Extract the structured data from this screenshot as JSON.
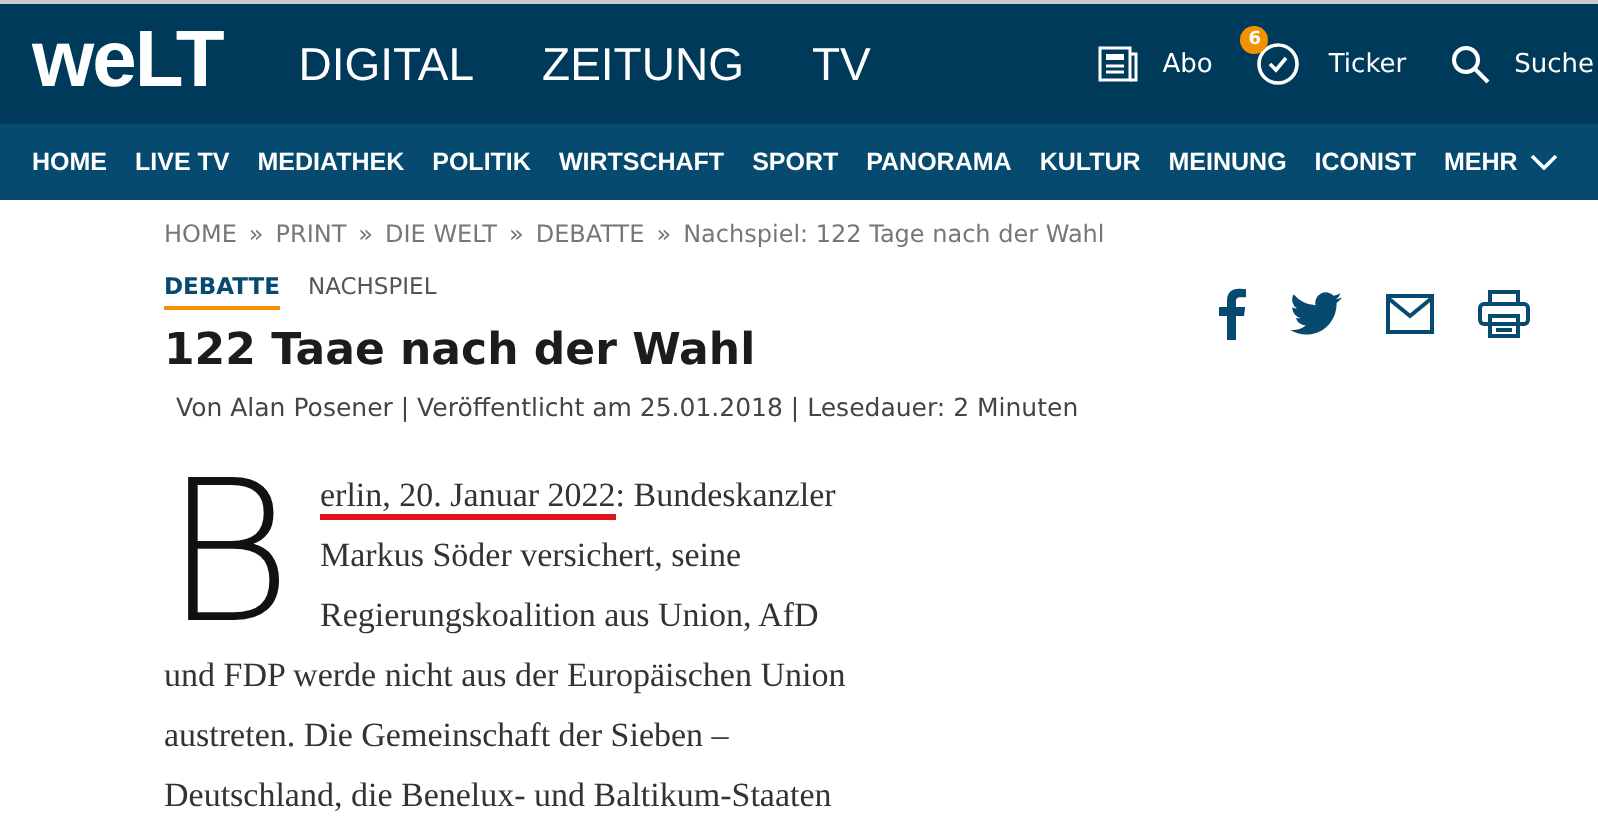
{
  "header": {
    "logo": "weLT",
    "sections": [
      "DIGITAL",
      "ZEITUNG",
      "TV"
    ],
    "abo": "Abo",
    "ticker": {
      "label": "Ticker",
      "badge": "6"
    },
    "search": "Suche"
  },
  "nav": [
    {
      "label": "HOME"
    },
    {
      "label": "LIVE TV"
    },
    {
      "label": "MEDIATHEK"
    },
    {
      "label": "POLITIK"
    },
    {
      "label": "WIRTSCHAFT"
    },
    {
      "label": "SPORT"
    },
    {
      "label": "PANORAMA"
    },
    {
      "label": "KULTUR"
    },
    {
      "label": "MEINUNG"
    },
    {
      "label": "ICONIST"
    },
    {
      "label": "MEHR",
      "dropdown": true
    }
  ],
  "breadcrumb": [
    "HOME",
    "PRINT",
    "DIE WELT",
    "DEBATTE",
    "Nachspiel: 122 Tage nach der Wahl"
  ],
  "breadcrumb_separator": "»",
  "tags": [
    {
      "label": "DEBATTE",
      "selected": true
    },
    {
      "label": "NACHSPIEL",
      "selected": false
    }
  ],
  "title": "122 Taae nach der Wahl",
  "byline": "Von Alan Posener | Veröffentlicht am 25.01.2018 | Lesedauer: 2 Minuten",
  "article": {
    "drop_cap": "B",
    "first_line_marked": "erlin, 20. Januar 2022",
    "first_line_rest": ": Bundeskanzler",
    "lines": [
      "Markus Söder versichert, seine",
      "Regierungskoalition aus Union, AfD",
      "und FDP werde nicht aus der Europäischen Union",
      "austreten. Die Gemeinschaft der Sieben –",
      "Deutschland, die Benelux- und Baltikum-Staaten"
    ]
  }
}
